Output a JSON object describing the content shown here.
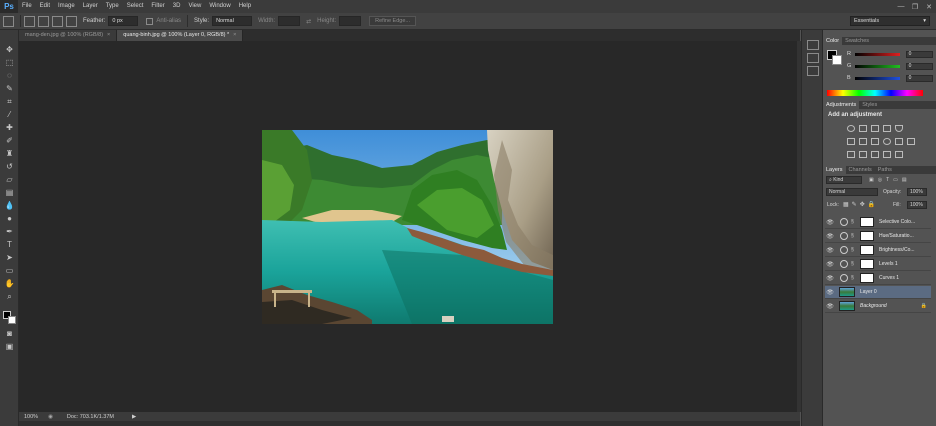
{
  "app": {
    "logo": "Ps"
  },
  "menu": [
    "File",
    "Edit",
    "Image",
    "Layer",
    "Type",
    "Select",
    "Filter",
    "3D",
    "View",
    "Window",
    "Help"
  ],
  "window_controls": [
    "—",
    "❐",
    "✕"
  ],
  "options": {
    "feather_label": "Feather:",
    "feather_value": "0 px",
    "antialias_label": "Anti-alias",
    "style_label": "Style:",
    "style_value": "Normal",
    "width_label": "Width:",
    "height_label": "Height:",
    "refine_edge": "Refine Edge...",
    "workspace": "Essentials"
  },
  "tabs": [
    {
      "label": "mang-den.jpg @ 100% (RGB/8)",
      "active": false
    },
    {
      "label": "quang-binh.jpg @ 100% (Layer 0, RGB/8) *",
      "active": true
    }
  ],
  "status": {
    "zoom": "100%",
    "doc": "Doc: 703.1K/1.37M"
  },
  "color_panel": {
    "tabs": [
      "Color",
      "Swatches"
    ],
    "rows": [
      {
        "letter": "R",
        "value": "0",
        "color": "#e02020"
      },
      {
        "letter": "G",
        "value": "0",
        "color": "#20c020"
      },
      {
        "letter": "B",
        "value": "0",
        "color": "#2050e0"
      }
    ]
  },
  "adjustments_panel": {
    "tabs": [
      "Adjustments",
      "Styles"
    ],
    "title": "Add an adjustment"
  },
  "layers_panel": {
    "tabs": [
      "Layers",
      "Channels",
      "Paths"
    ],
    "kind": "Kind",
    "blend_mode": "Normal",
    "opacity_label": "Opacity:",
    "opacity_value": "100%",
    "lock_label": "Lock:",
    "fill_label": "Fill:",
    "fill_value": "100%",
    "layers": [
      {
        "name": "Selective Colo...",
        "type": "adjustment",
        "selected": false
      },
      {
        "name": "Hue/Saturatio...",
        "type": "adjustment",
        "selected": false
      },
      {
        "name": "Brightness/Co...",
        "type": "adjustment",
        "selected": false
      },
      {
        "name": "Levels 1",
        "type": "adjustment",
        "selected": false
      },
      {
        "name": "Curves 1",
        "type": "adjustment",
        "selected": false
      },
      {
        "name": "Layer 0",
        "type": "image",
        "selected": true
      },
      {
        "name": "Background",
        "type": "image",
        "selected": false
      }
    ]
  }
}
